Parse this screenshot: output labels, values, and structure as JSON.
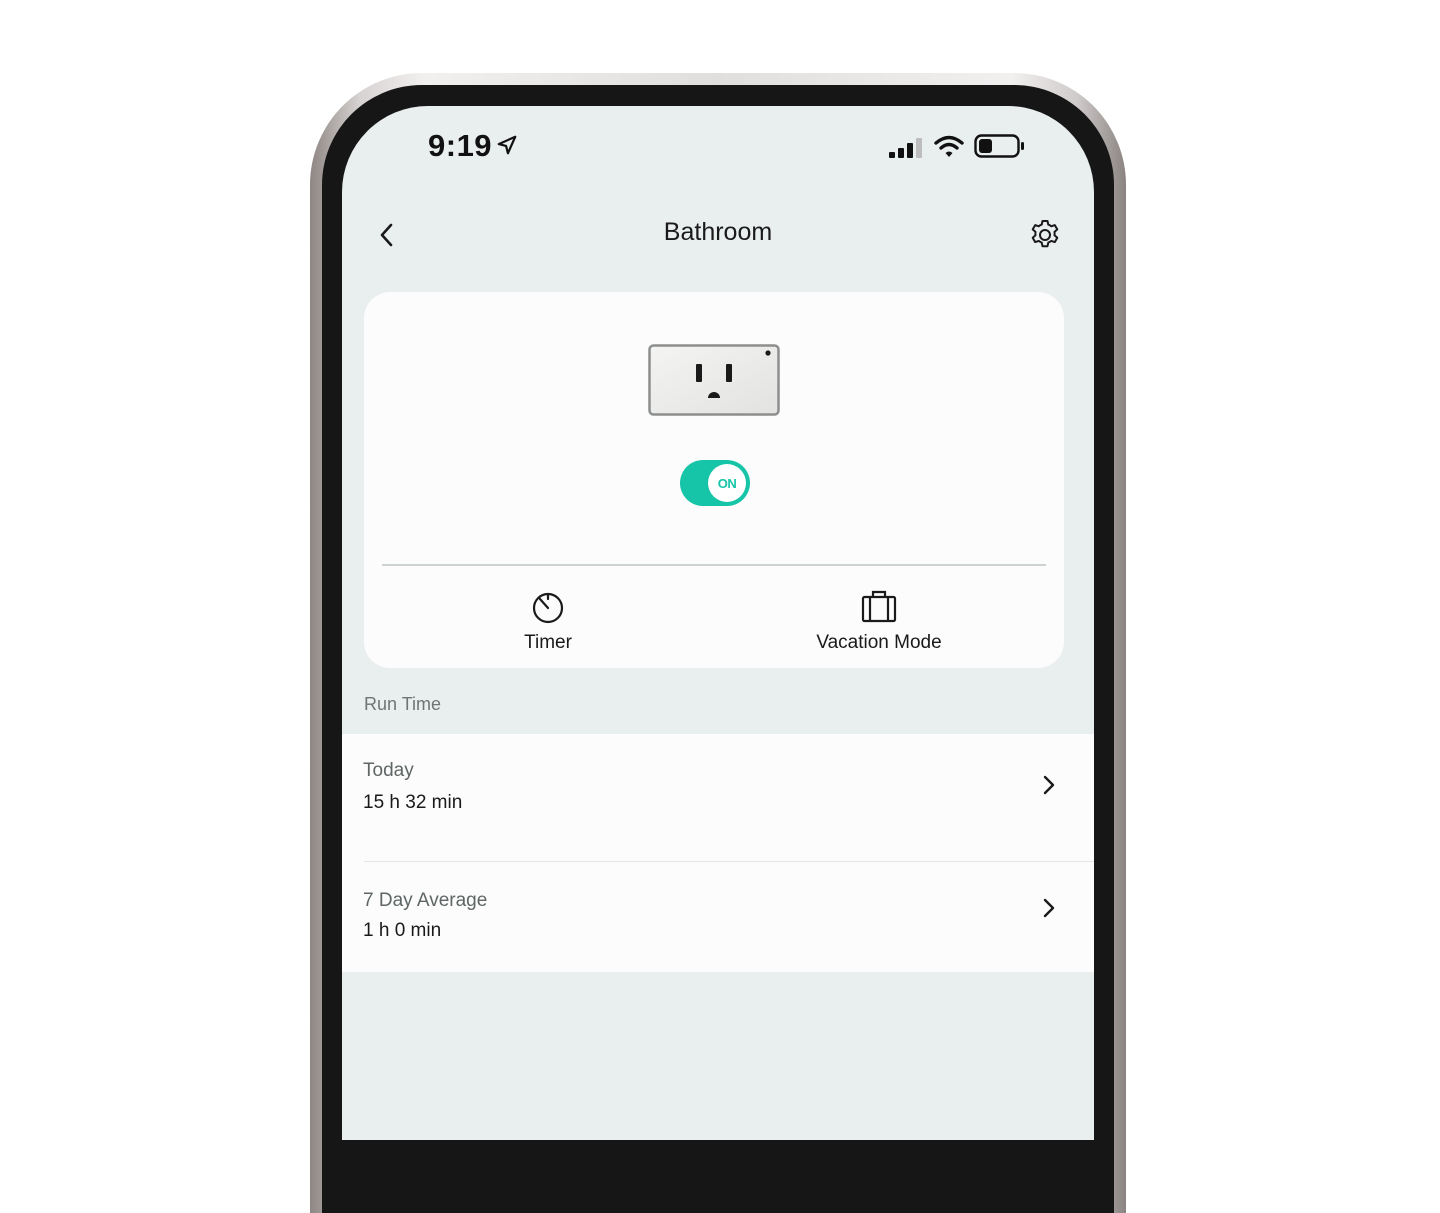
{
  "status_bar": {
    "time": "9:19",
    "icons": [
      "location-arrow-icon",
      "signal-icon",
      "wifi-icon",
      "battery-icon"
    ]
  },
  "header": {
    "title": "Bathroom",
    "back_icon": "chevron-left-icon",
    "settings_icon": "gear-icon"
  },
  "device": {
    "image": "outlet-icon",
    "toggle_label": "ON",
    "toggle_state": "on",
    "accent_color": "#16c4a8"
  },
  "actions": [
    {
      "label": "Timer",
      "icon": "timer-icon"
    },
    {
      "label": "Vacation Mode",
      "icon": "suitcase-icon"
    }
  ],
  "run_time": {
    "section_label": "Run Time",
    "rows": [
      {
        "title": "Today",
        "value": "15 h 32 min"
      },
      {
        "title": "7 Day Average",
        "value": "1 h 0 min"
      }
    ]
  }
}
